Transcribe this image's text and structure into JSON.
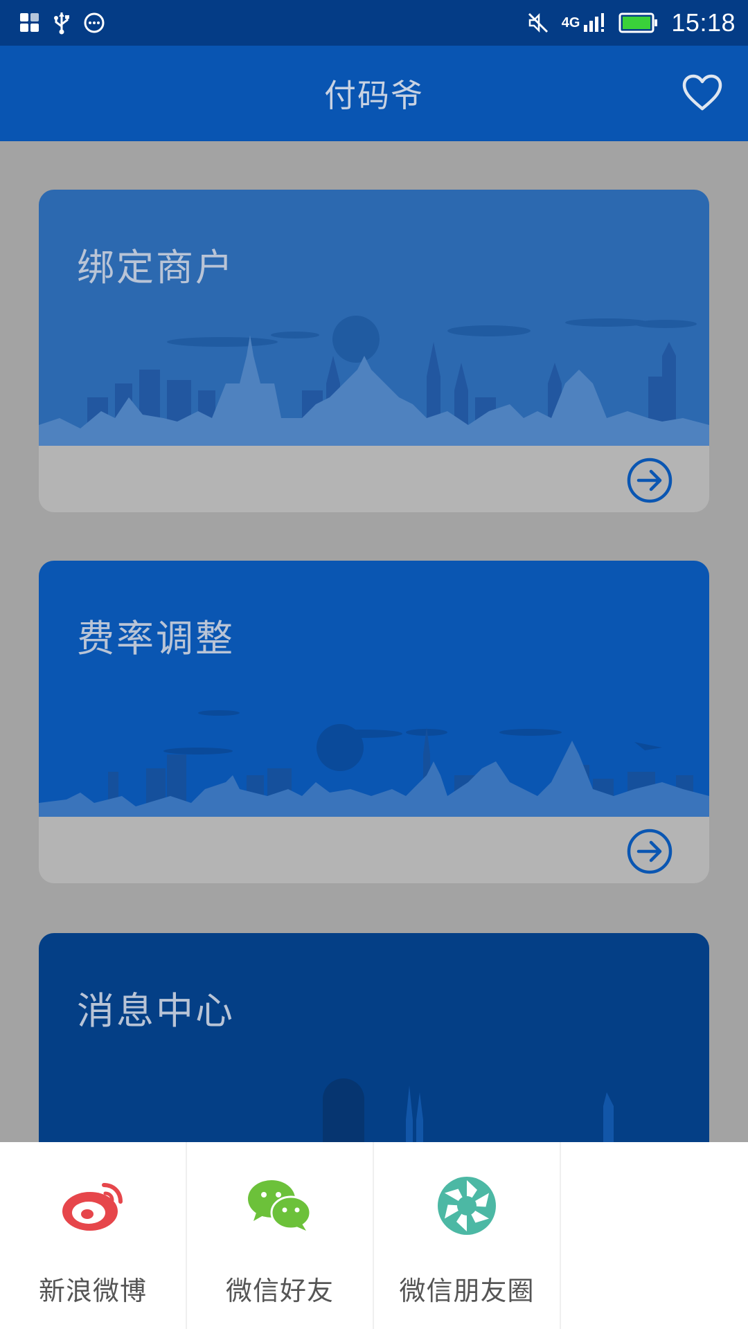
{
  "status_bar": {
    "network": "4G",
    "time": "15:18",
    "battery_color": "#3ad13a"
  },
  "app_bar": {
    "title": "付码爷",
    "favorite_icon": "heart-outline-icon"
  },
  "cards": [
    {
      "title": "绑定商户",
      "arrow_icon": "arrow-right-circle-icon",
      "color": "#2c69b0"
    },
    {
      "title": "费率调整",
      "arrow_icon": "arrow-right-circle-icon",
      "color": "#0a56b2"
    },
    {
      "title": "消息中心",
      "color": "#043f86"
    }
  ],
  "share_sheet": {
    "items": [
      {
        "label": "新浪微博",
        "icon": "weibo-icon",
        "color": "#e6464b"
      },
      {
        "label": "微信好友",
        "icon": "wechat-icon",
        "color": "#6cc13a"
      },
      {
        "label": "微信朋友圈",
        "icon": "wechat-moments-icon",
        "color": "#4cb8a4"
      },
      {
        "label": ""
      }
    ]
  },
  "colors": {
    "status_bar_bg": "#043c86",
    "app_bar_bg": "#0955b2",
    "page_bg": "#a3a3a3",
    "accent_blue": "#0a56b2"
  }
}
